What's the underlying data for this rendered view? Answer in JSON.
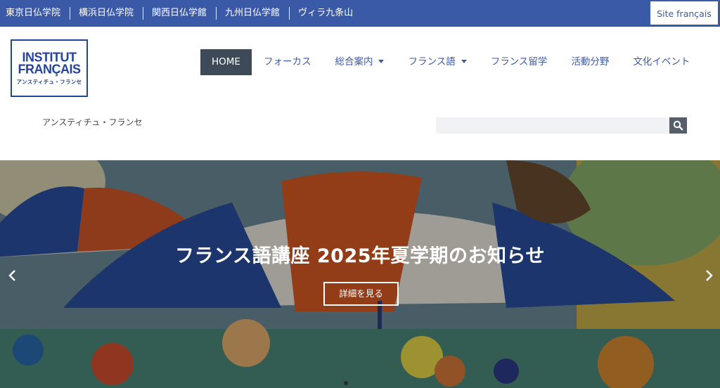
{
  "topbar": {
    "links": [
      "東京日仏学院",
      "横浜日仏学院",
      "関西日仏学館",
      "九州日仏学館",
      "ヴィラ九条山"
    ],
    "site_francais": "Site français"
  },
  "logo": {
    "line1": "INSTITUT",
    "line2": "FRANÇAIS",
    "line3": "アンスティチュ・フランセ"
  },
  "nav": {
    "home": "HOME",
    "focus": "フォーカス",
    "guide": "総合案内",
    "french": "フランス語",
    "study": "フランス留学",
    "activities": "活動分野",
    "events": "文化イベント"
  },
  "tagline": "アンスティチュ・フランセ",
  "search": {
    "placeholder": "",
    "icon": "search-icon"
  },
  "hero": {
    "title": "フランス語講座 2025年夏学期のお知らせ",
    "button": "詳細を見る",
    "prev_icon": "chevron-left-icon",
    "next_icon": "chevron-right-icon"
  },
  "colors": {
    "brand_blue": "#3a5aa8",
    "nav_active": "#3e4a57",
    "logo_blue": "#24439a"
  }
}
